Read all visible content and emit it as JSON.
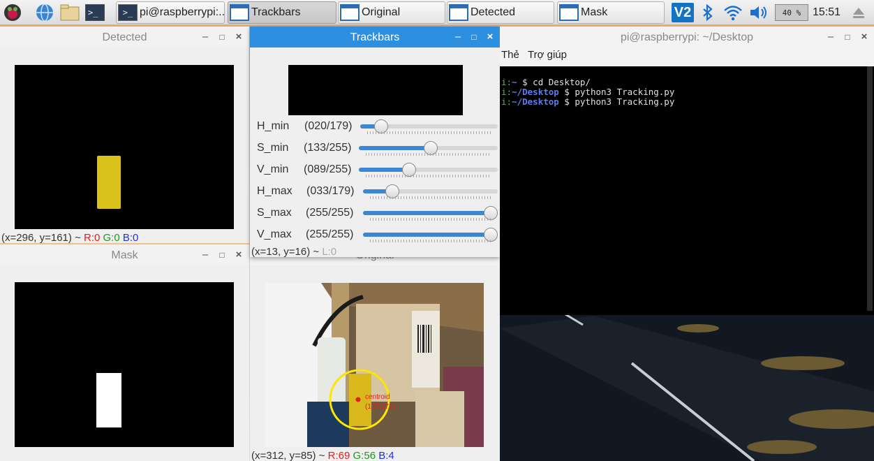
{
  "taskbar": {
    "tasks": [
      {
        "label": "pi@raspberrypi:..."
      },
      {
        "label": "Trackbars"
      },
      {
        "label": "Original"
      },
      {
        "label": "Detected"
      },
      {
        "label": "Mask"
      }
    ],
    "battery": "40 %",
    "clock": "15:51",
    "vnc_label": "V2"
  },
  "detected_window": {
    "title": "Detected",
    "status": {
      "coords": "(x=296, y=161) ~",
      "r": "R:0",
      "g": "G:0",
      "b": "B:0"
    }
  },
  "mask_window": {
    "title": "Mask"
  },
  "trackbars_window": {
    "title": "Trackbars",
    "sliders": [
      {
        "name": "H_min",
        "value": "(020/179)",
        "fraction": 0.112
      },
      {
        "name": "S_min",
        "value": "(133/255)",
        "fraction": 0.522
      },
      {
        "name": "V_min",
        "value": "(089/255)",
        "fraction": 0.349
      },
      {
        "name": "H_max",
        "value": "(033/179)",
        "fraction": 0.184
      },
      {
        "name": "S_max",
        "value": "(255/255)",
        "fraction": 1.0
      },
      {
        "name": "V_max",
        "value": "(255/255)",
        "fraction": 1.0
      }
    ],
    "status": {
      "coords": "(x=13, y=16) ~",
      "l": "L:0"
    }
  },
  "original_window": {
    "title": "Original",
    "overlay_label": "centroid",
    "overlay_coords": "(137,171)",
    "status": {
      "coords": "(x=312, y=85) ~",
      "r": "R:69",
      "g": "G:56",
      "b": "B:4"
    }
  },
  "terminal_window": {
    "title": "pi@raspberrypi: ~/Desktop",
    "menu": [
      "Thẻ",
      "Trợ giúp"
    ],
    "lines": [
      {
        "prefix": "i:",
        "path": "~",
        "cmd": " $ cd Desktop/"
      },
      {
        "prefix": "i:",
        "path": "~/Desktop",
        "cmd": " $ python3 Tracking.py"
      },
      {
        "prefix": "i:",
        "path": "~/Desktop",
        "cmd": " $ python3 Tracking.py"
      }
    ]
  },
  "colors": {
    "title_focused": "#2d8fe0",
    "slider_fill": "#3c87d2",
    "detected_yellow": "#d9c21a",
    "status_red": "#e02020",
    "status_green": "#1a9a1a",
    "status_blue": "#2030e0"
  }
}
